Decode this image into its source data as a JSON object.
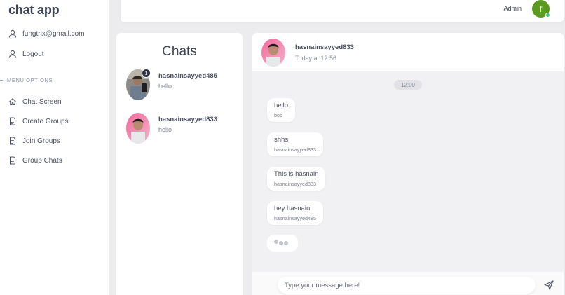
{
  "app": {
    "brand": "chat app"
  },
  "sidebar": {
    "account_email": "fungtrix@gmail.com",
    "logout_label": "Logout",
    "menu_header": "MENU OPTIONS",
    "items": [
      {
        "label": "Chat Screen",
        "icon": "home-icon"
      },
      {
        "label": "Create Groups",
        "icon": "document-icon"
      },
      {
        "label": "Join Groups",
        "icon": "document-icon"
      },
      {
        "label": "Group Chats",
        "icon": "document-icon"
      }
    ]
  },
  "topbar": {
    "admin_label": "Admin",
    "avatar_initial": "f",
    "online_color": "#3ac16e"
  },
  "chats": {
    "title": "Chats",
    "list": [
      {
        "name": "hasnainsayyed485",
        "preview": "hello",
        "unread": "1"
      },
      {
        "name": "hasnainsayyed833",
        "preview": "hello"
      }
    ]
  },
  "conversation": {
    "contact_name": "hasnainsayyed833",
    "status": "Today at 12:56",
    "time_divider": "12:00",
    "messages": [
      {
        "text": "hello",
        "sender": "bob"
      },
      {
        "text": "shhs",
        "sender": "hasnainsayyed833"
      },
      {
        "text": "This is hasnain",
        "sender": "hasnainsayyed833"
      },
      {
        "text": "hey hasnain",
        "sender": "hasnainsayyed485"
      }
    ],
    "input_placeholder": "Type your message here!",
    "send_icon": "send-icon"
  },
  "colors": {
    "accent_avatar": "#5a9a1e",
    "badge": "#2f3240"
  }
}
